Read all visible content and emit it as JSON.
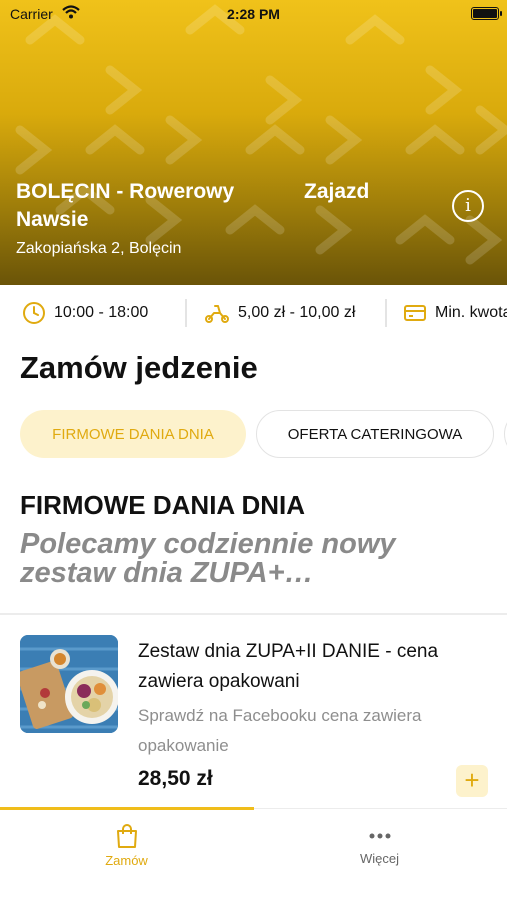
{
  "status_bar": {
    "carrier": "Carrier",
    "time": "2:28 PM"
  },
  "restaurant": {
    "name_left": "BOLĘCIN - Rowerowy Nawsie",
    "name_right": "Zajazd",
    "address": "Zakopiańska 2, Bolęcin"
  },
  "info_strip": {
    "hours": "10:00 - 18:00",
    "delivery_cost": "5,00 zł - 10,00 zł",
    "min_order_label": "Min. kwota zamówienia"
  },
  "page_title": "Zamów jedzenie",
  "categories": [
    {
      "label": "FIRMOWE DANIA DNIA",
      "active": true
    },
    {
      "label": "OFERTA CATERINGOWA",
      "active": false
    }
  ],
  "category_section": {
    "title": "FIRMOWE DANIA DNIA",
    "description": "Polecamy codziennie nowy zestaw dnia ZUPA+…"
  },
  "products": [
    {
      "name": "Zestaw dnia ZUPA+II DANIE - cena zawiera opakowani",
      "description": "Sprawdź na Facebooku cena zawiera opakowanie",
      "price": "28,50 zł",
      "add_label": "+"
    }
  ],
  "bottom_nav": {
    "order_label": "Zamów",
    "more_label": "Więcej"
  },
  "colors": {
    "accent": "#e0aa10",
    "accent_light": "#fdf2cc",
    "hero_top": "#f0c21a",
    "hero_bottom": "#6a5408"
  }
}
